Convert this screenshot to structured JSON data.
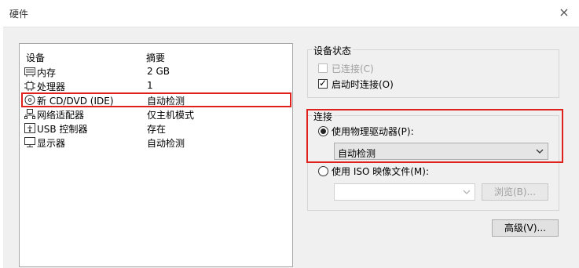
{
  "window": {
    "title": "硬件",
    "close_glyph": "×"
  },
  "device_list": {
    "headers": {
      "device": "设备",
      "summary": "摘要"
    },
    "items": [
      {
        "name": "内存",
        "summary": "2 GB",
        "icon": "memory-icon"
      },
      {
        "name": "处理器",
        "summary": "1",
        "icon": "processor-icon"
      },
      {
        "name": "新 CD/DVD (IDE)",
        "summary": "自动检测",
        "icon": "cd-dvd-icon",
        "selected": true
      },
      {
        "name": "网络适配器",
        "summary": "仅主机模式",
        "icon": "network-adapter-icon"
      },
      {
        "name": "USB 控制器",
        "summary": "存在",
        "icon": "usb-icon"
      },
      {
        "name": "显示器",
        "summary": "自动检测",
        "icon": "monitor-icon"
      }
    ]
  },
  "device_status": {
    "label": "设备状态",
    "connected": {
      "label": "已连接(C)",
      "checked": false,
      "enabled": false
    },
    "connect_at_power_on": {
      "label": "启动时连接(O)",
      "checked": true,
      "enabled": true
    }
  },
  "connection": {
    "label": "连接",
    "use_physical_drive": {
      "label": "使用物理驱动器(P):",
      "selected": true
    },
    "physical_drive_value": "自动检测",
    "use_iso_image": {
      "label": "使用 ISO 映像文件(M):",
      "selected": false
    },
    "iso_path_value": "",
    "browse_label": "浏览(B)..."
  },
  "advanced_label": "高级(V)...",
  "colors": {
    "highlight_border": "#e0201a",
    "dialog_bg": "#f0f0f0"
  }
}
